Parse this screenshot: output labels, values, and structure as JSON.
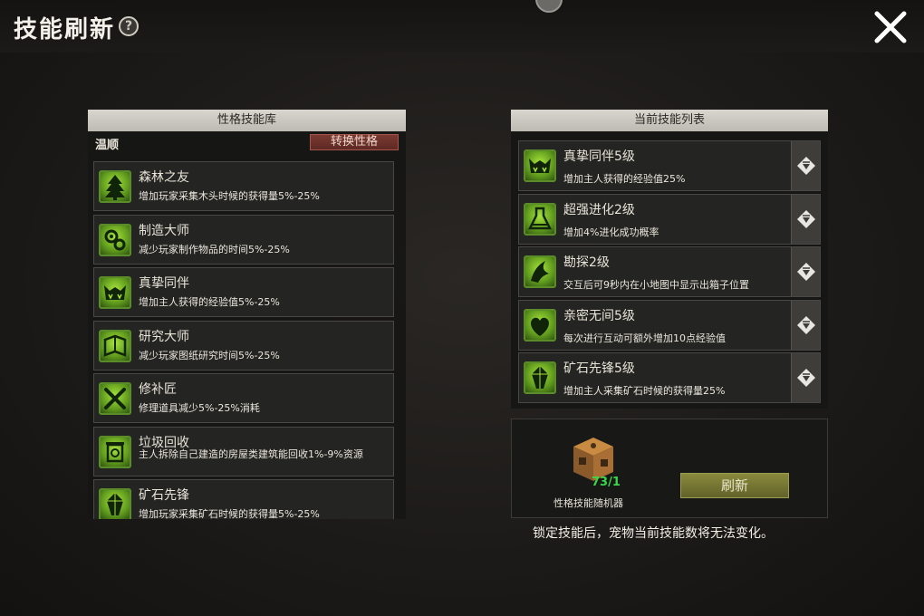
{
  "header": {
    "title": "技能刷新",
    "help_glyph": "?"
  },
  "library": {
    "title": "性格技能库",
    "personality": "温顺",
    "switch_label": "转换性格",
    "skills": [
      {
        "name": "森林之友",
        "desc": "增加玩家采集木头时候的获得量5%-25%",
        "icon": "tree-icon"
      },
      {
        "name": "制造大师",
        "desc": "减少玩家制作物品的时间5%-25%",
        "icon": "gears-icon"
      },
      {
        "name": "真挚同伴",
        "desc": "增加主人获得的经验值5%-25%",
        "icon": "monster-face-icon"
      },
      {
        "name": "研究大师",
        "desc": "减少玩家图纸研究时间5%-25%",
        "icon": "book-icon"
      },
      {
        "name": "修补匠",
        "desc": "修理道具减少5%-25%消耗",
        "icon": "tools-icon"
      },
      {
        "name": "垃圾回收",
        "desc": "主人拆除自己建造的房屋类建筑能回收1%-9%资源",
        "icon": "recycle-bin-icon"
      },
      {
        "name": "矿石先锋",
        "desc": "增加玩家采集矿石时候的获得量5%-25%",
        "icon": "crystal-icon"
      }
    ]
  },
  "current": {
    "title": "当前技能列表",
    "skills": [
      {
        "name": "真挚同伴5级",
        "desc": "增加主人获得的经验值25%",
        "icon": "monster-face-icon"
      },
      {
        "name": "超强进化2级",
        "desc": "增加4%进化成功概率",
        "icon": "flask-icon"
      },
      {
        "name": "勘探2级",
        "desc": "交互后可9秒内在小地图中显示出箱子位置",
        "icon": "claw-icon"
      },
      {
        "name": "亲密无间5级",
        "desc": "每次进行互动可额外增加10点经验值",
        "icon": "hearts-icon"
      },
      {
        "name": "矿石先锋5级",
        "desc": "增加主人采集矿石时候的获得量25%",
        "icon": "crystal-icon"
      }
    ]
  },
  "randomizer": {
    "count": "73/1",
    "label": "性格技能随机器",
    "refresh_label": "刷新"
  },
  "note": "锁定技能后，宠物当前技能数将无法变化。",
  "colors": {
    "icon_green": "#8fcf2e",
    "switch_red": "#6e3129",
    "refresh_olive": "#7a7a34",
    "count_green": "#39d84a"
  }
}
